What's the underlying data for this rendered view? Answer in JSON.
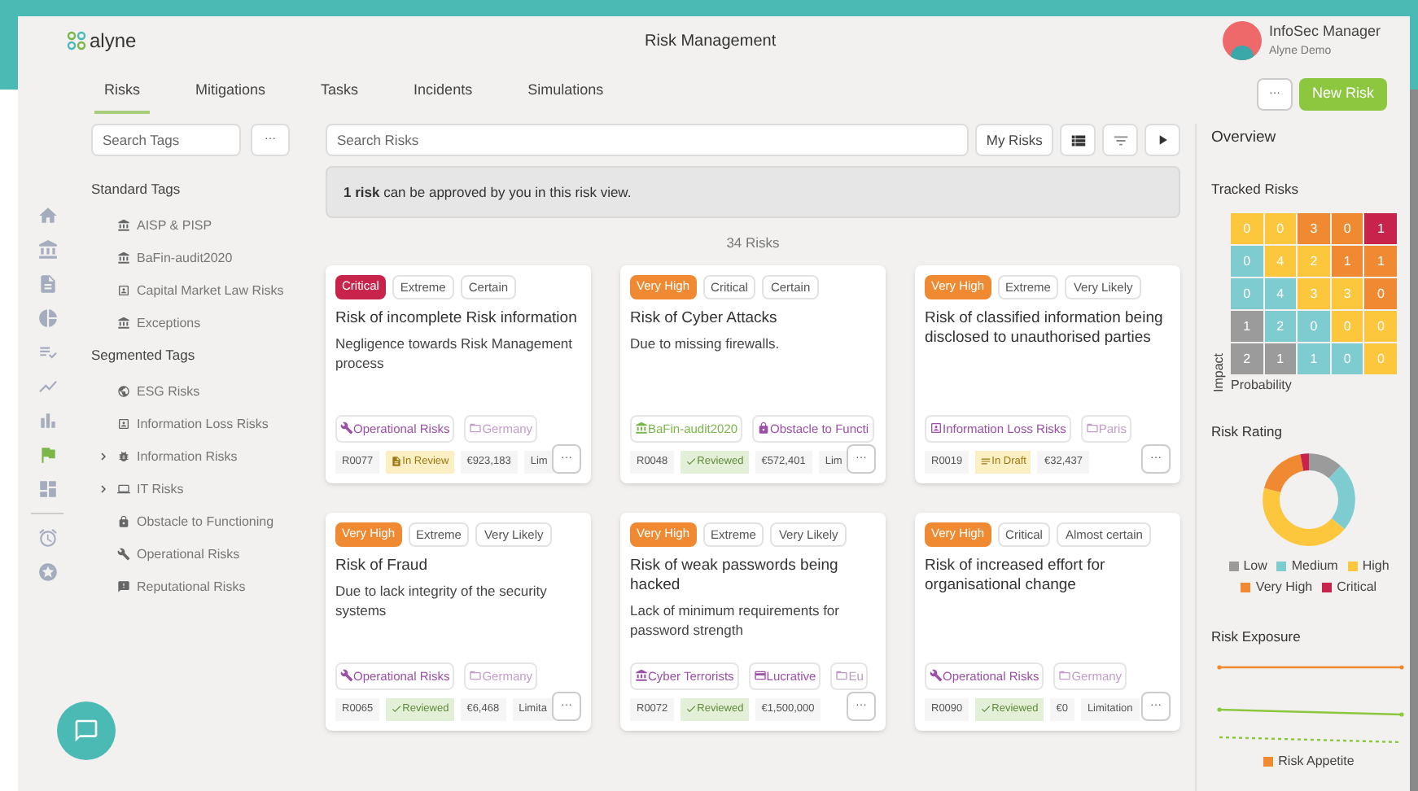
{
  "header": {
    "logo": "alyne",
    "title": "Risk Management",
    "user": {
      "name": "InfoSec Manager",
      "org": "Alyne Demo"
    }
  },
  "nav_icons": [
    {
      "selected": false
    },
    {
      "selected": false
    },
    {
      "selected": false
    },
    {
      "selected": false
    },
    {
      "selected": false
    },
    {
      "selected": false
    },
    {
      "selected": false
    },
    {
      "selected": true
    },
    {
      "selected": false
    },
    {
      "selected": false
    },
    {
      "selected": false
    }
  ],
  "tabs": [
    {
      "label": "Risks",
      "selected": true
    },
    {
      "label": "Mitigations",
      "selected": false
    },
    {
      "label": "Tasks",
      "selected": false
    },
    {
      "label": "Incidents",
      "selected": false
    },
    {
      "label": "Simulations",
      "selected": false
    }
  ],
  "actions": {
    "more": "···",
    "new": "New Risk"
  },
  "tag_search": {
    "placeholder": "Search Tags",
    "more": "···"
  },
  "tag_groups": [
    {
      "title": "Standard Tags",
      "items": [
        {
          "label": "AISP & PISP",
          "kind": "tag"
        },
        {
          "label": "BaFin-audit2020",
          "kind": "tag"
        },
        {
          "label": "Capital Market Law Risks",
          "kind": "tag"
        },
        {
          "label": "Exceptions",
          "kind": "tag"
        }
      ]
    },
    {
      "title": "Segmented Tags",
      "items": [
        {
          "label": "ESG Risks",
          "kind": "tag"
        },
        {
          "label": "Information Loss Risks",
          "kind": "tag"
        },
        {
          "label": "Information Risks",
          "kind": "folder",
          "expanded": false
        },
        {
          "label": "IT Risks",
          "kind": "folder",
          "expanded": false
        },
        {
          "label": "Obstacle to Functioning",
          "kind": "tag"
        },
        {
          "label": "Operational Risks",
          "kind": "tag"
        },
        {
          "label": "Reputational Risks",
          "kind": "tag"
        }
      ]
    }
  ],
  "search": {
    "placeholder": "Search Risks",
    "my_risks": "My Risks"
  },
  "notice": "**1 risk** can be approved by you in this risk view.",
  "count": "34 Risks",
  "card_menu": "···",
  "cards": [
    {
      "kind": "critical",
      "badge": "Critical",
      "impact": "Extreme",
      "probability": "Certain",
      "title": "Risk of incomplete Risk information",
      "description": "Negligence towards Risk Management process",
      "tags": [
        {
          "label": "Operational Risks",
          "kind": "operational",
          "color": "#9b4fa8"
        },
        {
          "label": "Germany",
          "kind": "location",
          "color": "#c49ccb"
        }
      ],
      "id": "R0077",
      "status": {
        "label": "In Review",
        "kind": "review"
      },
      "amount": "€923,183",
      "extra": "Lim"
    },
    {
      "kind": "very_high",
      "badge": "Very High",
      "impact": "Critical",
      "probability": "Certain",
      "title": "Risk of Cyber Attacks",
      "description": "Due to missing firewalls.",
      "tags": [
        {
          "label": "BaFin-audit2020",
          "kind": "regulatory",
          "color": "#7ab648"
        },
        {
          "label": "Obstacle to Functi",
          "kind": "obstacle",
          "color": "#9b4fa8"
        }
      ],
      "id": "R0048",
      "status": {
        "label": "Reviewed",
        "kind": "reviewed"
      },
      "amount": "€572,401",
      "extra": "Lim"
    },
    {
      "kind": "very_high",
      "badge": "Very High",
      "impact": "Extreme",
      "probability": "Very Likely",
      "title": "Risk of classified information being disclosed to unauthorised parties",
      "tags": [
        {
          "label": "Information Loss Risks",
          "kind": "information",
          "color": "#9b4fa8"
        },
        {
          "label": "Paris",
          "kind": "location",
          "color": "#c49ccb"
        }
      ],
      "id": "R0019",
      "status": {
        "label": "In Draft",
        "kind": "draft"
      },
      "amount": "€32,437"
    },
    {
      "kind": "very_high",
      "badge": "Very High",
      "impact": "Extreme",
      "probability": "Very Likely",
      "title": "Risk of Fraud",
      "description": "Due to lack integrity of the security systems",
      "tags": [
        {
          "label": "Operational Risks",
          "kind": "operational",
          "color": "#9b4fa8"
        },
        {
          "label": "Germany",
          "kind": "location",
          "color": "#c49ccb"
        }
      ],
      "id": "R0065",
      "status": {
        "label": "Reviewed",
        "kind": "reviewed"
      },
      "amount": "€6,468",
      "extra": "Limita"
    },
    {
      "kind": "very_high",
      "badge": "Very High",
      "impact": "Extreme",
      "probability": "Very Likely",
      "title": "Risk of weak passwords being hacked",
      "description": "Lack of minimum requirements for password strength",
      "tags": [
        {
          "label": "Cyber Terrorists",
          "kind": "threat",
          "color": "#9b4fa8"
        },
        {
          "label": "Lucrative",
          "kind": "financial",
          "color": "#9b4fa8"
        },
        {
          "label": "Eu",
          "kind": "location",
          "color": "#b89ac0"
        }
      ],
      "id": "R0072",
      "status": {
        "label": "Reviewed",
        "kind": "reviewed"
      },
      "amount": "€1,500,000"
    },
    {
      "kind": "very_high",
      "badge": "Very High",
      "impact": "Critical",
      "probability": "Almost certain",
      "title": "Risk of increased effort for organisational change",
      "tags": [
        {
          "label": "Operational Risks",
          "kind": "operational",
          "color": "#9b4fa8"
        },
        {
          "label": "Germany",
          "kind": "location",
          "color": "#c49ccb"
        }
      ],
      "id": "R0090",
      "status": {
        "label": "Reviewed",
        "kind": "reviewed"
      },
      "amount": "€0",
      "extra": "Limitation"
    }
  ],
  "overview": {
    "title": "Overview",
    "tracked": {
      "title": "Tracked Risks",
      "y_label": "Impact",
      "x_label": "Probability",
      "rows": [
        {
          "cells": [
            {
              "value": "0",
              "kind": "high"
            },
            {
              "value": "0",
              "kind": "high"
            },
            {
              "value": "3",
              "kind": "very_high"
            },
            {
              "value": "0",
              "kind": "very_high"
            },
            {
              "value": "1",
              "kind": "critical"
            }
          ]
        },
        {
          "cells": [
            {
              "value": "0",
              "kind": "medium"
            },
            {
              "value": "4",
              "kind": "high"
            },
            {
              "value": "2",
              "kind": "high"
            },
            {
              "value": "1",
              "kind": "very_high"
            },
            {
              "value": "1",
              "kind": "very_high"
            }
          ]
        },
        {
          "cells": [
            {
              "value": "0",
              "kind": "medium"
            },
            {
              "value": "4",
              "kind": "medium"
            },
            {
              "value": "3",
              "kind": "high"
            },
            {
              "value": "3",
              "kind": "high"
            },
            {
              "value": "0",
              "kind": "very_high"
            }
          ]
        },
        {
          "cells": [
            {
              "value": "1",
              "kind": "low"
            },
            {
              "value": "2",
              "kind": "medium"
            },
            {
              "value": "0",
              "kind": "medium"
            },
            {
              "value": "0",
              "kind": "high"
            },
            {
              "value": "0",
              "kind": "high"
            }
          ]
        },
        {
          "cells": [
            {
              "value": "2",
              "kind": "low"
            },
            {
              "value": "1",
              "kind": "low"
            },
            {
              "value": "1",
              "kind": "medium"
            },
            {
              "value": "0",
              "kind": "medium"
            },
            {
              "value": "0",
              "kind": "high"
            }
          ]
        }
      ]
    },
    "rating": {
      "title": "Risk Rating",
      "legend": [
        {
          "label": "Low",
          "color": "#9b9b9b"
        },
        {
          "label": "Medium",
          "color": "#7ecbd0"
        },
        {
          "label": "High",
          "color": "#fcc73c"
        },
        {
          "label": "Very High",
          "color": "#f08a32"
        },
        {
          "label": "Critical",
          "color": "#c8234a"
        }
      ]
    },
    "exposure": {
      "title": "Risk Exposure",
      "legend": [
        {
          "label": "Risk Appetite",
          "color": "#f08a32"
        }
      ]
    }
  }
}
